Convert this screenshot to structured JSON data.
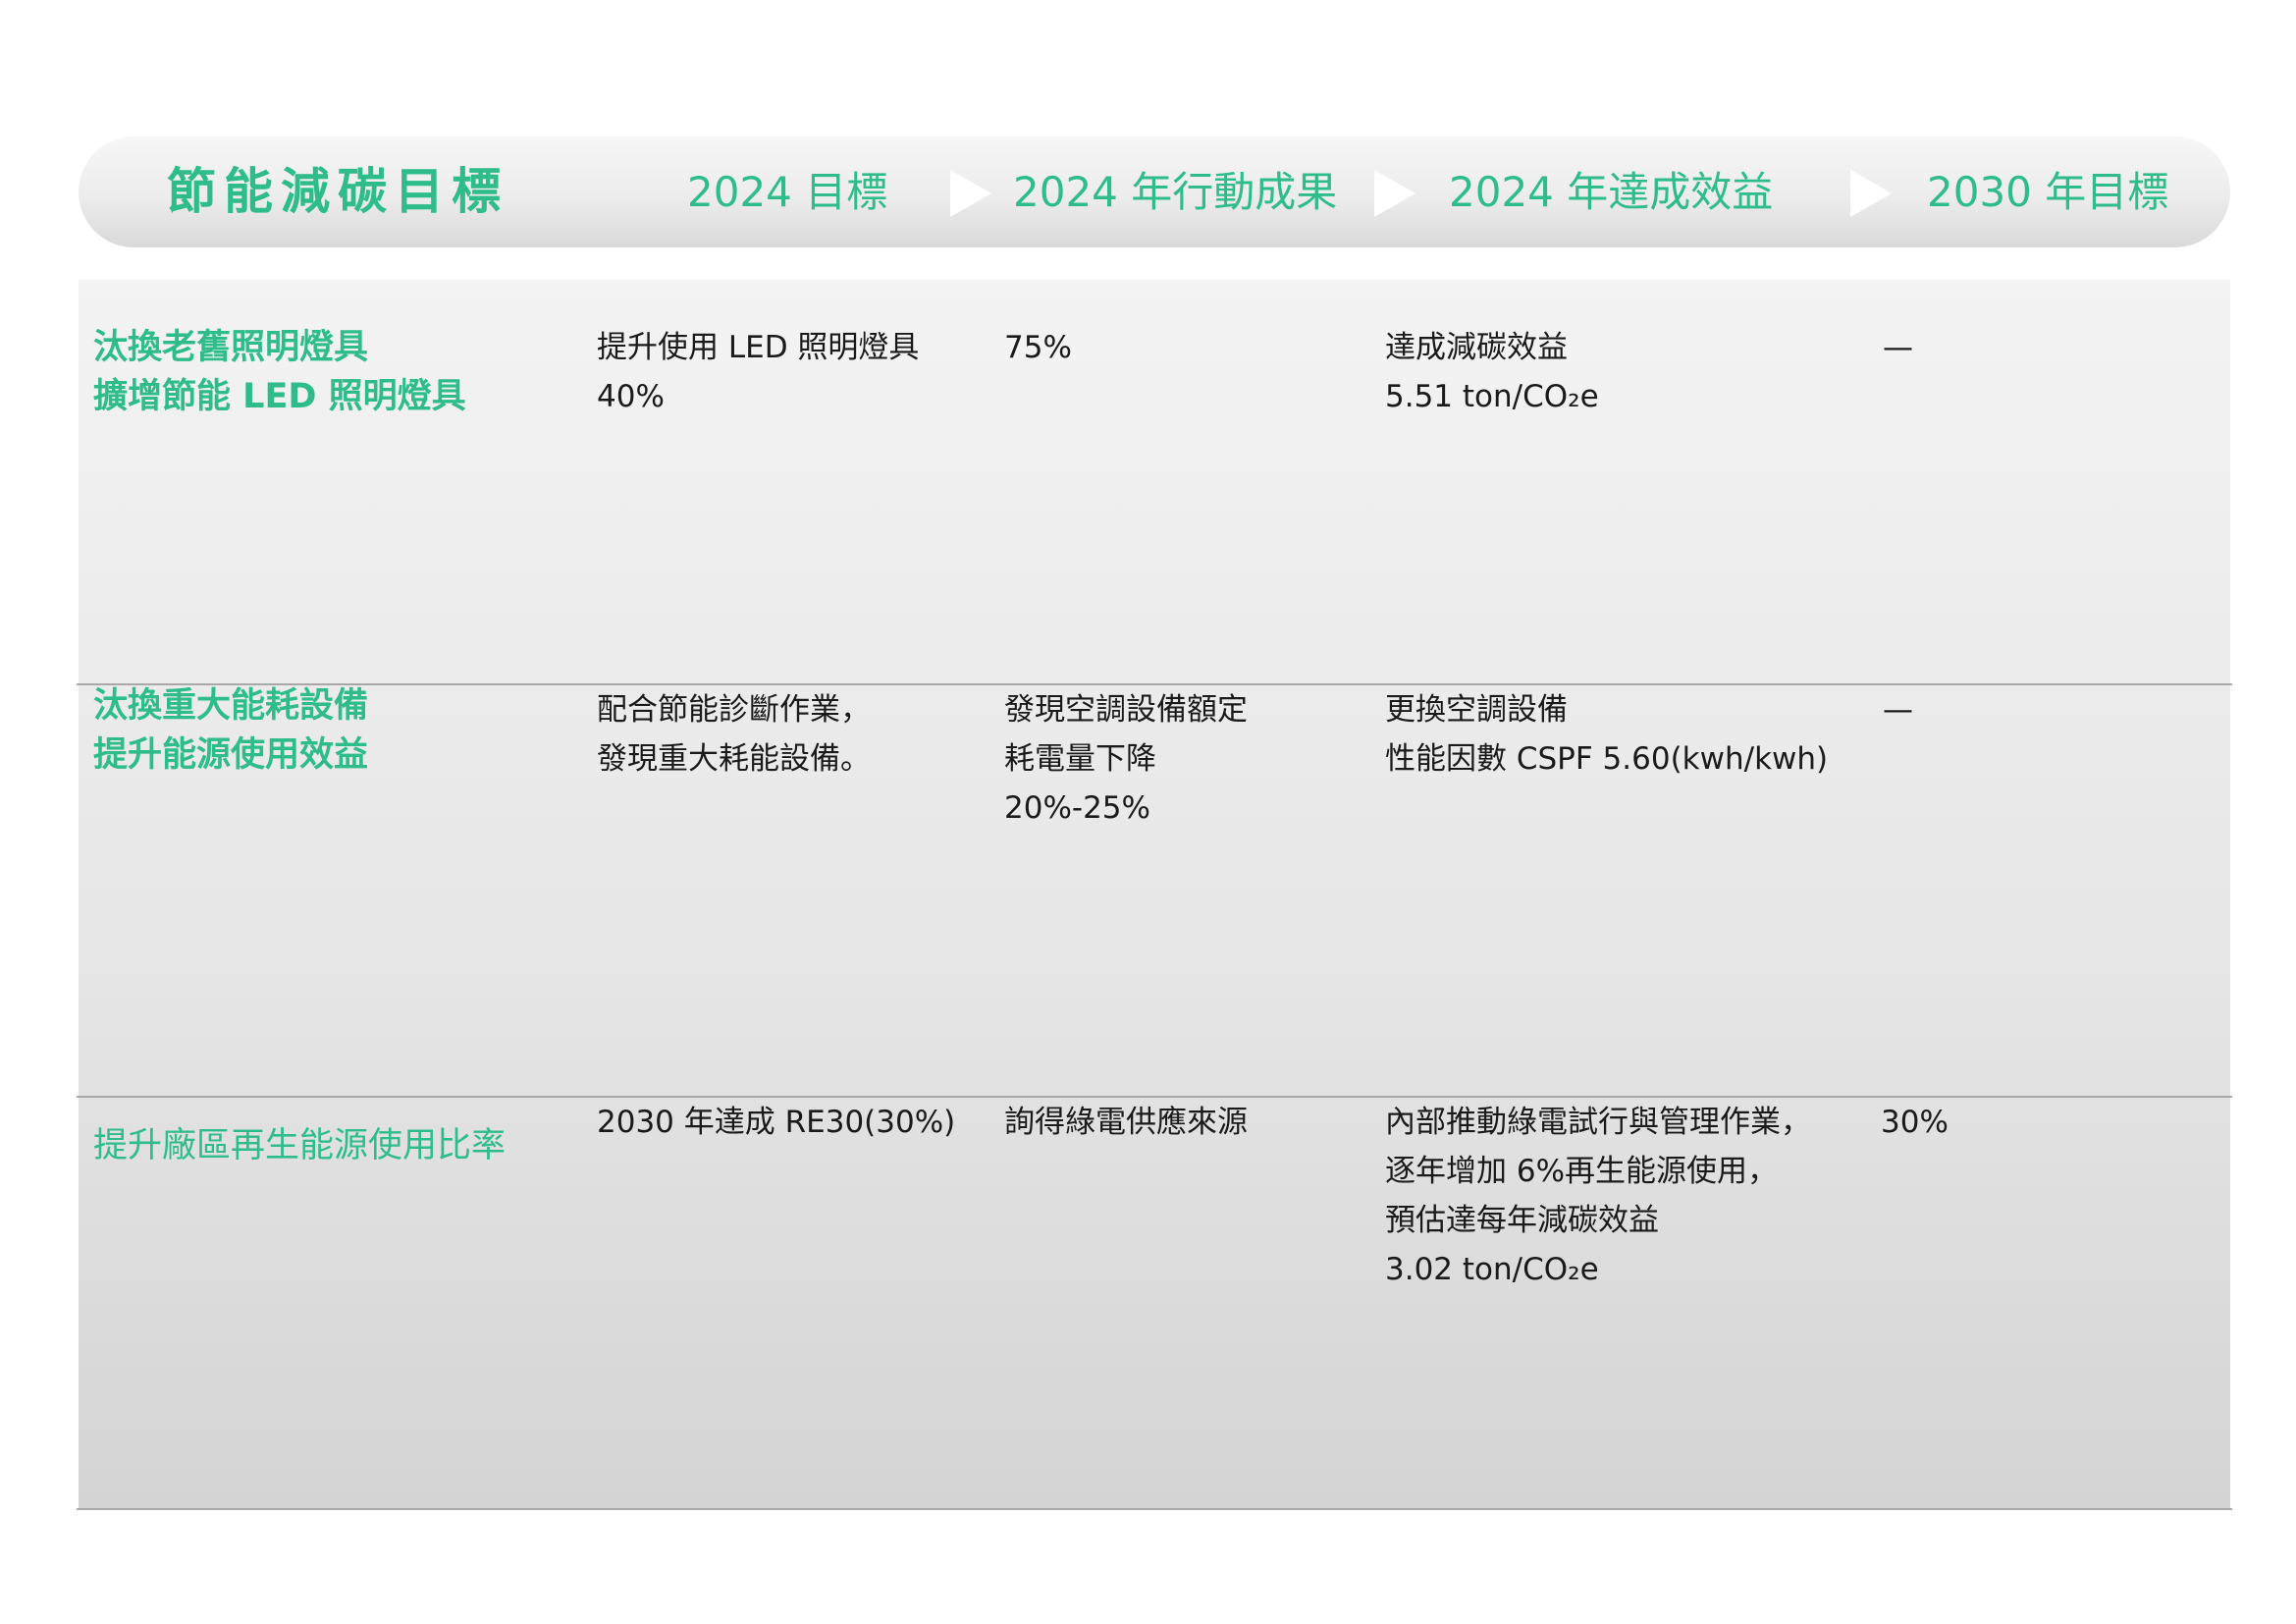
{
  "header": {
    "title": "節能減碳目標",
    "columns": [
      "2024 目標",
      "2024 年行動成果",
      "2024 年達成效益",
      "2030 年目標"
    ]
  },
  "rows": [
    {
      "goal": "汰換老舊照明燈具\n擴增節能 LED 照明燈具",
      "target_2024": "提升使用 LED 照明燈具\n40%",
      "action_2024": "75%",
      "benefit_2024": "達成減碳效益\n5.51 ton/CO₂e",
      "target_2030": "—"
    },
    {
      "goal": "汰換重大能耗設備\n提升能源使用效益",
      "target_2024": "配合節能診斷作業，\n發現重大耗能設備。",
      "action_2024": "發現空調設備額定\n耗電量下降\n20%-25%",
      "benefit_2024": "更換空調設備\n性能因數 CSPF 5.60(kwh/kwh)",
      "target_2030": "—"
    },
    {
      "goal": "提升廠區再生能源使用比率",
      "target_2024": "2030 年達成 RE30(30%)",
      "action_2024": "詢得綠電供應來源",
      "benefit_2024": "內部推動綠電試行與管理作業，\n逐年增加 6%再生能源使用，\n預估達每年減碳效益\n3.02 ton/CO₂e",
      "target_2030": "30%"
    }
  ],
  "colors": {
    "accent": "#2dbc8a",
    "text": "#1a1a1a",
    "divider": "#a8a8a8"
  }
}
